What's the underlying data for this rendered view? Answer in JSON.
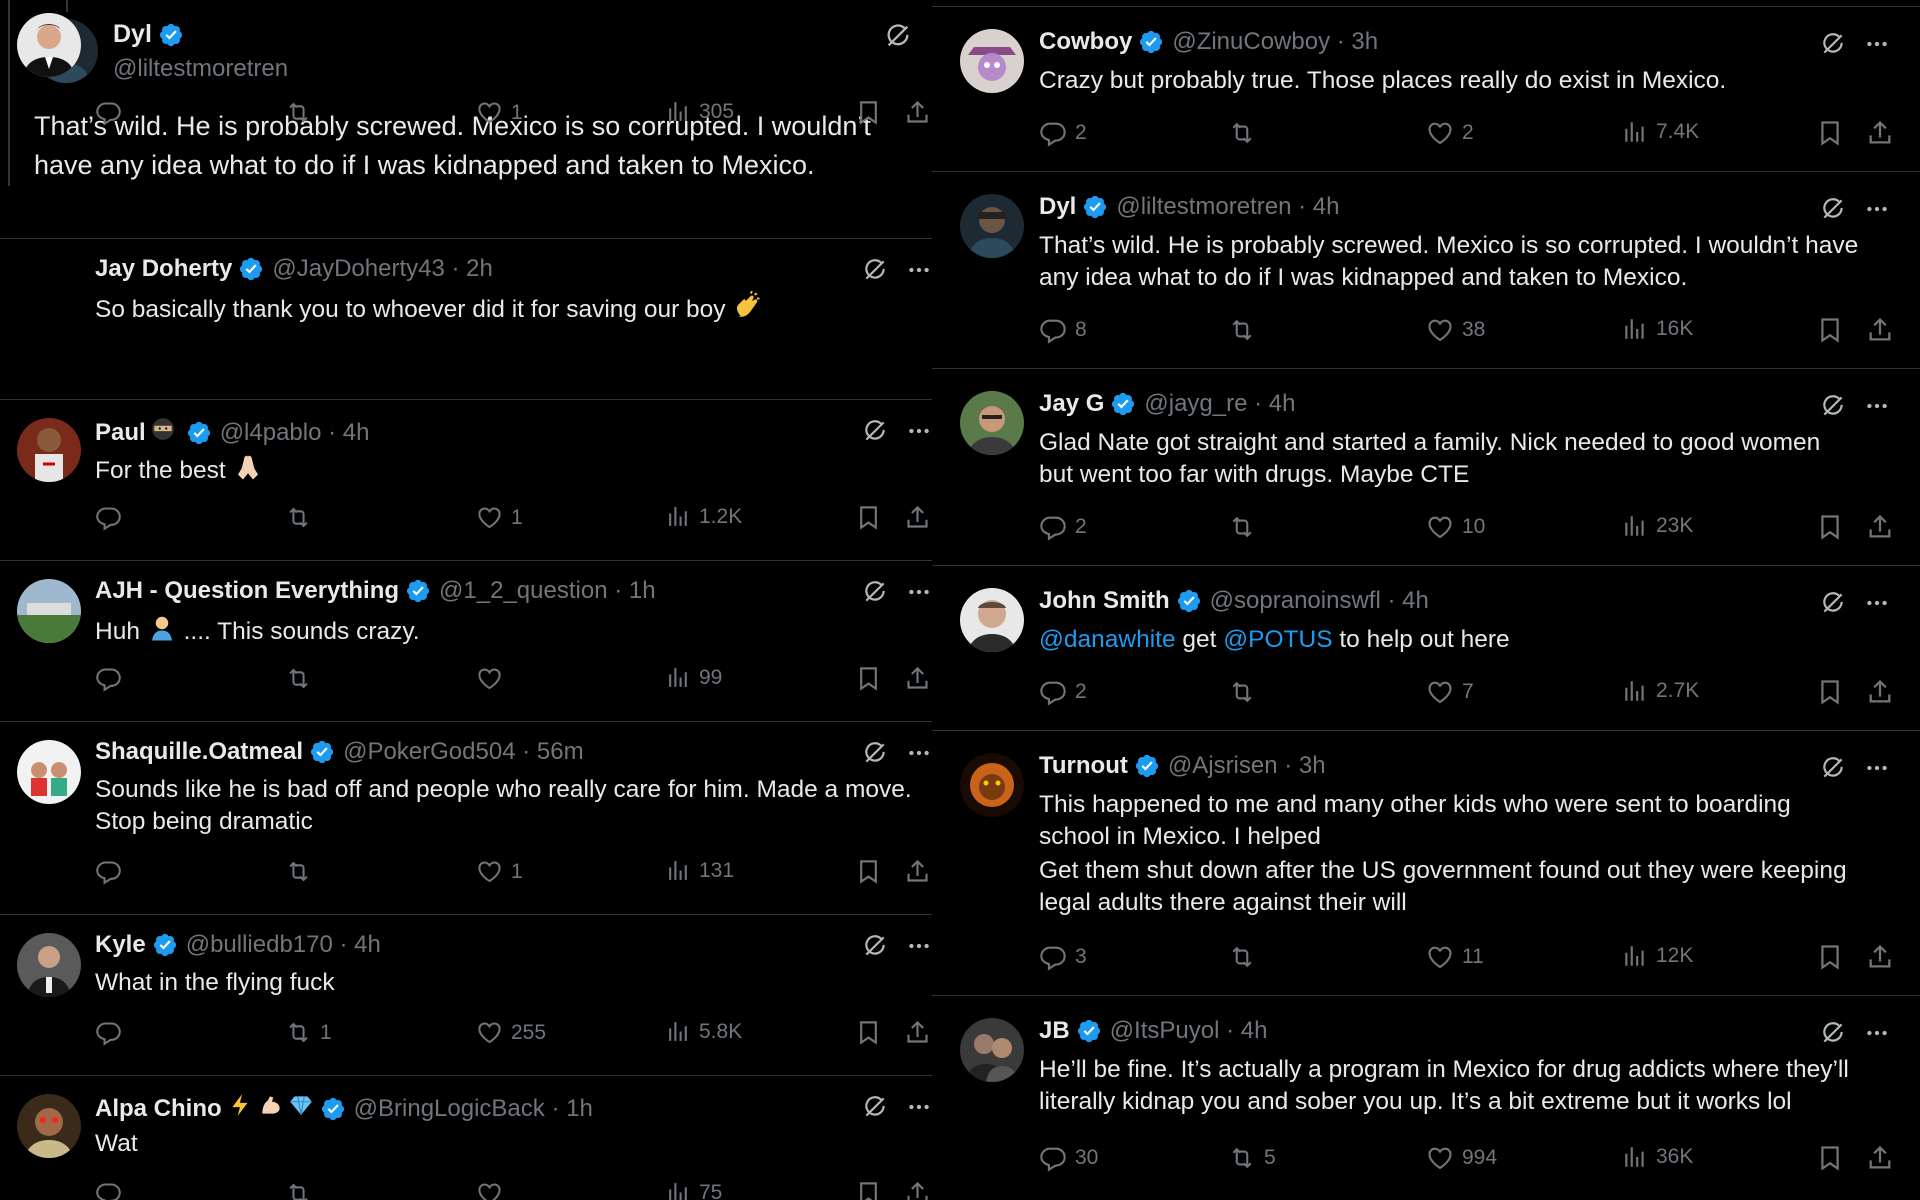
{
  "focus": {
    "name": "Dyl",
    "handle": "@liltestmoretren",
    "text": "That’s wild. He is probably screwed. Mexico is so corrupted. I wouldn’t have any idea what to do if I was kidnapped and taken to Mexico."
  },
  "left_replies": [
    {
      "name": "Jay Doherty",
      "handle": "@JayDoherty43 · 2h",
      "text": "So basically thank you to whoever did it for saving our boy",
      "reply": "",
      "repost": "",
      "like": "1",
      "views": "305"
    },
    {
      "name": "Paul",
      "handle": "@l4pablo · 4h",
      "text": "For the best",
      "reply": "",
      "repost": "",
      "like": "1",
      "views": "1.2K"
    },
    {
      "name": "AJH - Question Everything",
      "handle": "@1_2_question · 1h",
      "text": "Huh .... This sounds crazy.",
      "text_a": "Huh",
      "text_b": ".... This sounds crazy.",
      "reply": "",
      "repost": "",
      "like": "",
      "views": "99"
    },
    {
      "name": "Shaquille.Oatmeal",
      "handle": "@PokerGod504 · 56m",
      "text_1": "Sounds like he is bad off and people who really care for him. Made a move.",
      "text_2": "Stop being dramatic",
      "reply": "",
      "repost": "",
      "like": "1",
      "views": "131"
    },
    {
      "name": "Kyle",
      "handle": "@bulliedb170 · 4h",
      "text": "What in the flying fuck",
      "reply": "",
      "repost": "1",
      "like": "255",
      "views": "5.8K"
    },
    {
      "name": "Alpa Chino",
      "handle": "@BringLogicBack · 1h",
      "text": "Wat",
      "reply": "",
      "repost": "",
      "like": "",
      "views": "75"
    }
  ],
  "right_replies": [
    {
      "name": "Cowboy",
      "handle": "@ZinuCowboy · 3h",
      "text": "Crazy but probably true. Those places really do exist in Mexico.",
      "reply": "2",
      "repost": "",
      "like": "2",
      "views": "7.4K"
    },
    {
      "name": "Dyl",
      "handle": "@liltestmoretren · 4h",
      "text_1": "That’s wild. He is probably screwed. Mexico is so corrupted. I wouldn’t have",
      "text_2": "any idea what to do if I was kidnapped and taken to Mexico.",
      "reply": "8",
      "repost": "",
      "like": "38",
      "views": "16K"
    },
    {
      "name": "Jay G",
      "handle": "@jayg_re · 4h",
      "text_1": "Glad Nate got straight and started a family. Nick needed to good women",
      "text_2": "but went too far with drugs. Maybe CTE",
      "reply": "2",
      "repost": "",
      "like": "10",
      "views": "23K"
    },
    {
      "name": "John Smith",
      "handle": "@sopranoinswfl · 4h",
      "mention_1": "@danawhite",
      "mid": " get ",
      "mention_2": "@POTUS",
      "tail": " to help out here",
      "reply": "2",
      "repost": "",
      "like": "7",
      "views": "2.7K"
    },
    {
      "name": "Turnout",
      "handle": "@Ajsrisen · 3h",
      "text_1": "This happened to me and many other kids who were sent to boarding",
      "text_2": "school in Mexico. I helped",
      "text_3": "Get them shut down after the US government found out they were keeping",
      "text_4": "legal adults there against their will",
      "reply": "3",
      "repost": "",
      "like": "11",
      "views": "12K"
    },
    {
      "name": "JB",
      "handle": "@ItsPuyol · 4h",
      "text_1": "He’ll be fine. It’s actually a program in Mexico for drug addicts where they’ll",
      "text_2": "literally kidnap you and sober you up. It’s a bit extreme but it works lol",
      "reply": "30",
      "repost": "5",
      "like": "994",
      "views": "36K"
    }
  ],
  "colors": {
    "background": "#000000",
    "text": "#e7e9ea",
    "muted": "#71767b",
    "verified": "#1d9bf0",
    "divider": "#2f3336"
  }
}
